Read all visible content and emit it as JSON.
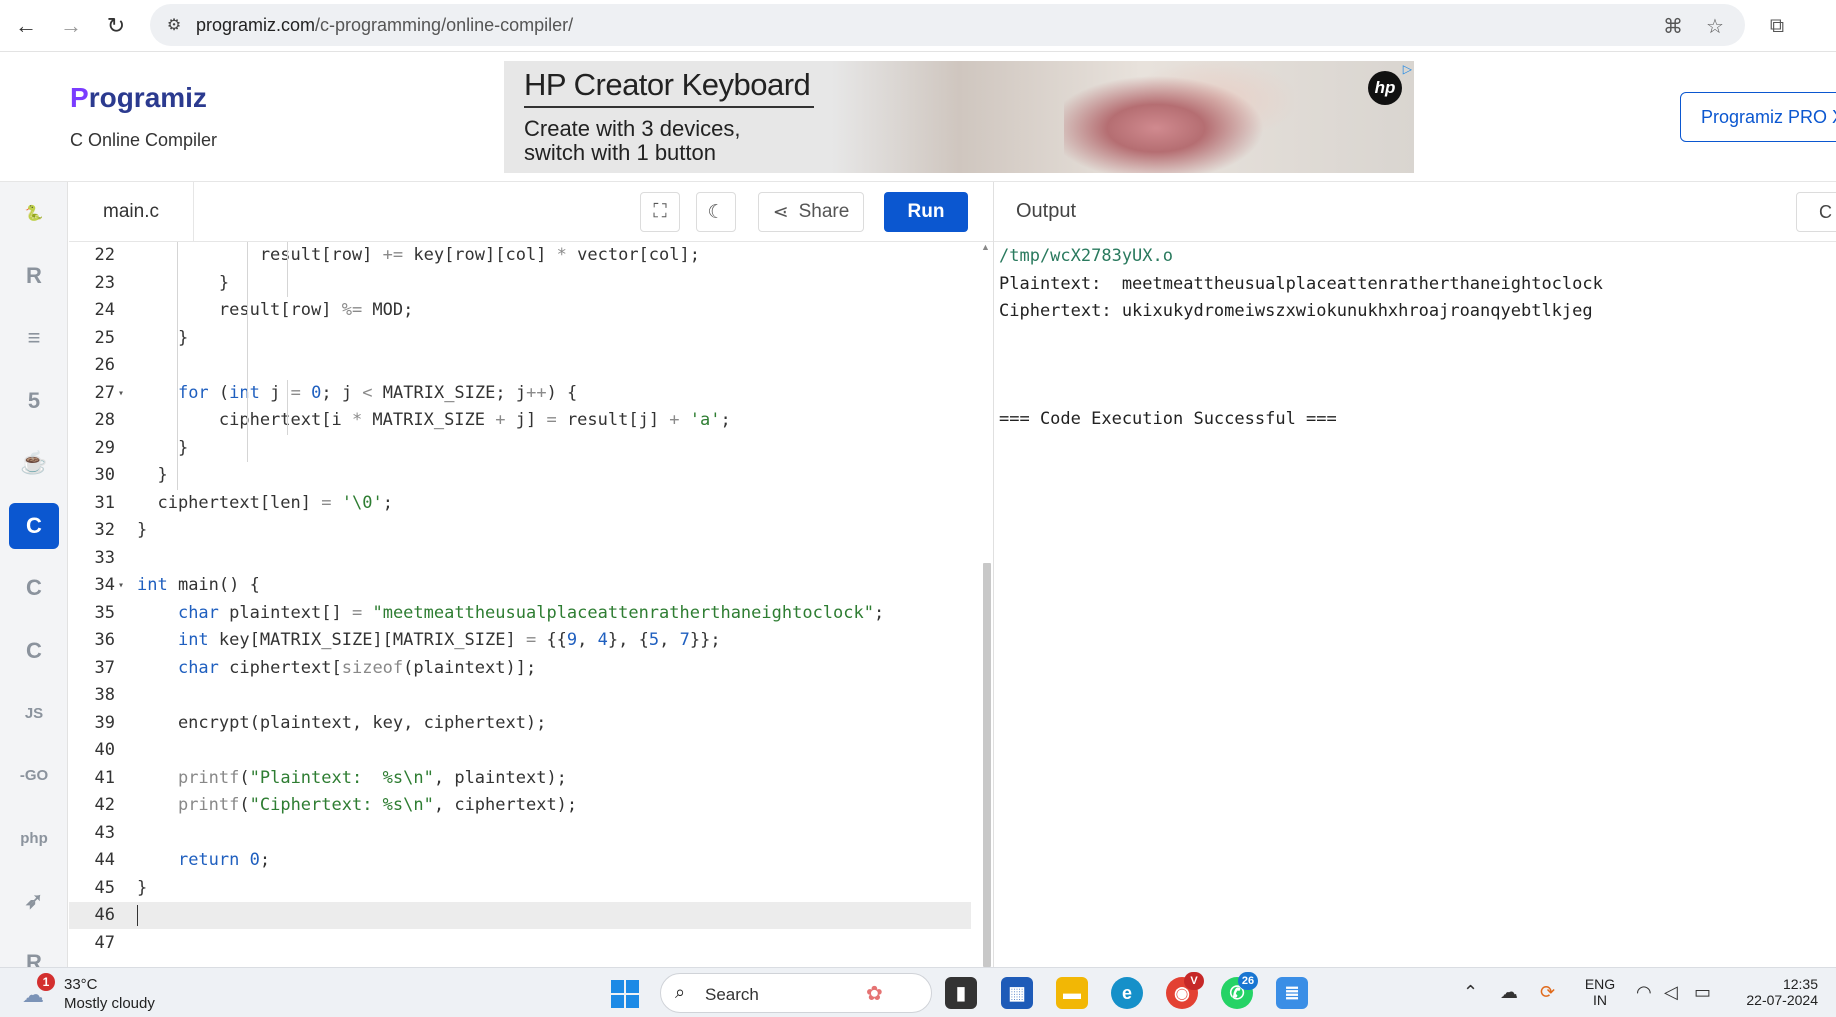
{
  "browser": {
    "url_host": "programiz.com",
    "url_path": "/c-programming/online-compiler/"
  },
  "header": {
    "logo_text": "rogramiz",
    "logo_p": "P",
    "subtitle": "C Online Compiler",
    "pro_button": "Programiz PRO X"
  },
  "ad": {
    "title": "HP Creator Keyboard",
    "line1": "Create with 3 devices,",
    "line2": "switch with 1 button",
    "brand": "hp"
  },
  "sidebar": {
    "items": [
      {
        "name": "python",
        "glyph": "🐍"
      },
      {
        "name": "r",
        "glyph": "R"
      },
      {
        "name": "sql",
        "glyph": "≡"
      },
      {
        "name": "html",
        "glyph": "5"
      },
      {
        "name": "java",
        "glyph": "☕"
      },
      {
        "name": "c",
        "glyph": "C",
        "active": true
      },
      {
        "name": "cpp",
        "glyph": "C"
      },
      {
        "name": "csharp",
        "glyph": "C"
      },
      {
        "name": "js",
        "glyph": "JS"
      },
      {
        "name": "go",
        "glyph": "-GO"
      },
      {
        "name": "php",
        "glyph": "php"
      },
      {
        "name": "swift",
        "glyph": "➶"
      },
      {
        "name": "rust",
        "glyph": "R"
      }
    ]
  },
  "editor": {
    "file_name": "main.c",
    "share_label": "Share",
    "run_label": "Run",
    "lines": [
      {
        "n": "22",
        "fold": false,
        "html": "            result[row] <span class='op'>+=</span> key[row][col] <span class='op'>*</span> vector[col];"
      },
      {
        "n": "23",
        "fold": false,
        "html": "        }"
      },
      {
        "n": "24",
        "fold": false,
        "html": "        result[row] <span class='op'>%=</span> MOD;"
      },
      {
        "n": "25",
        "fold": false,
        "html": "    }"
      },
      {
        "n": "26",
        "fold": false,
        "html": ""
      },
      {
        "n": "27",
        "fold": true,
        "html": "    <span class='kw'>for</span> (<span class='kw'>int</span> j <span class='op'>=</span> <span class='num'>0</span>; j <span class='op'>&lt;</span> MATRIX_SIZE; j<span class='op'>++</span>) {"
      },
      {
        "n": "28",
        "fold": false,
        "html": "        ciphertext[i <span class='op'>*</span> MATRIX_SIZE <span class='op'>+</span> j] <span class='op'>=</span> result[j] <span class='op'>+</span> <span class='str'>'a'</span>;"
      },
      {
        "n": "29",
        "fold": false,
        "html": "    }"
      },
      {
        "n": "30",
        "fold": false,
        "html": "  }"
      },
      {
        "n": "31",
        "fold": false,
        "html": "  ciphertext[len] <span class='op'>=</span> <span class='str'>'\\0'</span>;"
      },
      {
        "n": "32",
        "fold": false,
        "html": "}"
      },
      {
        "n": "33",
        "fold": false,
        "html": ""
      },
      {
        "n": "34",
        "fold": true,
        "html": "<span class='kw'>int</span> main() {"
      },
      {
        "n": "35",
        "fold": false,
        "html": "    <span class='kw'>char</span> plaintext[] <span class='op'>=</span> <span class='str'>\"meetmeattheusualplaceattenratherthaneightoclock\"</span>;"
      },
      {
        "n": "36",
        "fold": false,
        "html": "    <span class='kw'>int</span> key[MATRIX_SIZE][MATRIX_SIZE] <span class='op'>=</span> {{<span class='num'>9</span>, <span class='num'>4</span>}, {<span class='num'>5</span>, <span class='num'>7</span>}};"
      },
      {
        "n": "37",
        "fold": false,
        "html": "    <span class='kw'>char</span> ciphertext[<span class='fn'>sizeof</span>(plaintext)];"
      },
      {
        "n": "38",
        "fold": false,
        "html": ""
      },
      {
        "n": "39",
        "fold": false,
        "html": "    encrypt(plaintext, key, ciphertext);"
      },
      {
        "n": "40",
        "fold": false,
        "html": ""
      },
      {
        "n": "41",
        "fold": false,
        "html": "    <span class='fn'>printf</span>(<span class='str'>\"Plaintext:  %s\\n\"</span>, plaintext);"
      },
      {
        "n": "42",
        "fold": false,
        "html": "    <span class='fn'>printf</span>(<span class='str'>\"Ciphertext: %s\\n\"</span>, ciphertext);"
      },
      {
        "n": "43",
        "fold": false,
        "html": ""
      },
      {
        "n": "44",
        "fold": false,
        "html": "    <span class='kw'>return</span> <span class='num'>0</span>;"
      },
      {
        "n": "45",
        "fold": false,
        "html": "}"
      },
      {
        "n": "46",
        "fold": false,
        "html": "",
        "current": true
      },
      {
        "n": "47",
        "fold": false,
        "html": ""
      }
    ]
  },
  "output": {
    "title": "Output",
    "clear_label": "C",
    "lines": [
      {
        "text": "/tmp/wcX2783yUX.o",
        "kind": "path"
      },
      {
        "text": "Plaintext:  meetmeattheusualplaceattenratherthaneightoclock",
        "kind": "text"
      },
      {
        "text": "Ciphertext: ukixukydromeiwszxwiokunukhxhroajroanqyebtlkjeg",
        "kind": "text"
      },
      {
        "text": "",
        "kind": "text"
      },
      {
        "text": "=== Code Execution Successful ===",
        "kind": "text"
      }
    ]
  },
  "taskbar": {
    "weather_badge": "1",
    "weather_temp": "33°C",
    "weather_desc": "Mostly cloudy",
    "search_placeholder": "Search",
    "whatsapp_badge": "26",
    "chrome_badge": "V",
    "lang_top": "ENG",
    "lang_bottom": "IN",
    "time": "12:35",
    "date": "22-07-2024"
  },
  "colors": {
    "accent": "#0b57d0",
    "string": "#2e7d32",
    "keyword": "#1f5fbf"
  }
}
